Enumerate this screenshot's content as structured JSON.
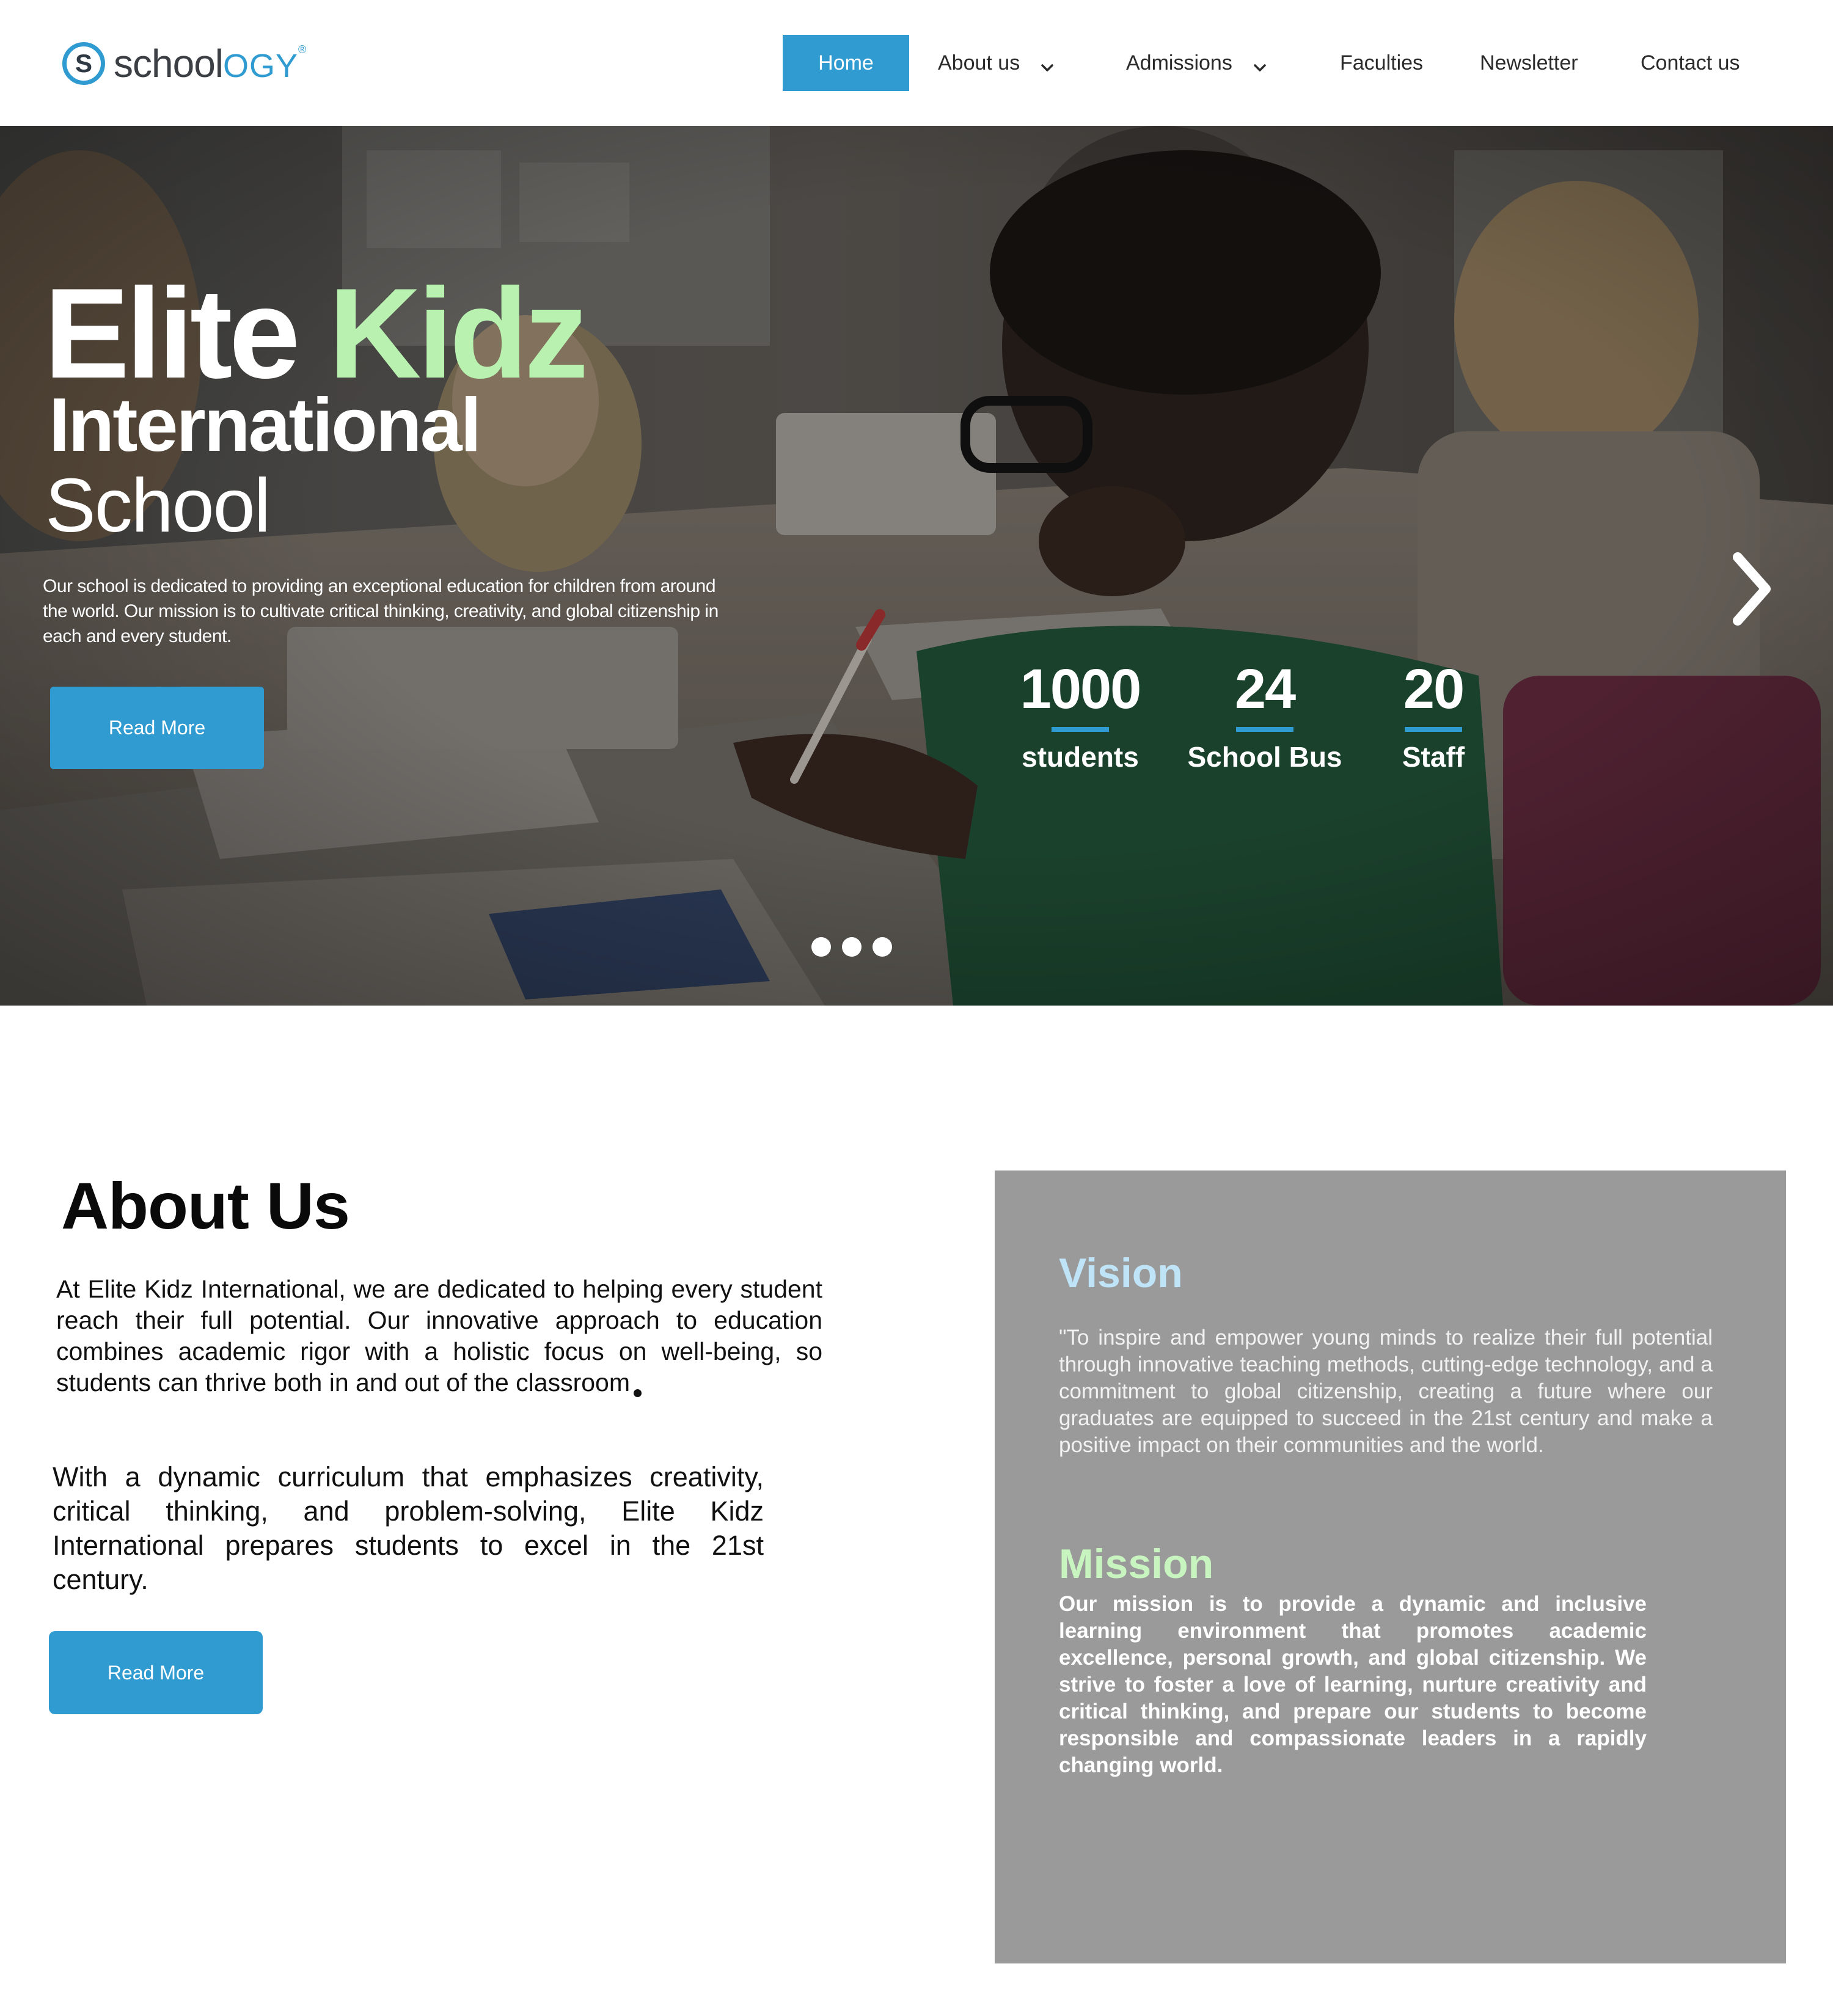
{
  "brand": {
    "logo_letter": "S",
    "logo_part1": "school",
    "logo_part2": "OGY",
    "logo_tm": "®",
    "accent_color": "#2f9bd0"
  },
  "nav": {
    "home": "Home",
    "about": "About us",
    "admissions": "Admissions",
    "faculties": "Faculties",
    "newsletter": "Newsletter",
    "contact": "Contact us"
  },
  "hero": {
    "title_white": "Elite",
    "title_green": "Kidz",
    "title_line2": "International",
    "title_line3": "School",
    "description": "Our school is dedicated to providing an exceptional education for children from around the world. Our mission is to cultivate critical thinking, creativity, and global citizenship in each and every student.",
    "cta": "Read More",
    "stats": [
      {
        "value": "1000",
        "label": "students"
      },
      {
        "value": "24",
        "label": "School Bus"
      },
      {
        "value": "20",
        "label": "Staff"
      }
    ],
    "slides": 3,
    "next_icon": "chevron-right-icon"
  },
  "about": {
    "title": "About Us",
    "paragraph1": "At Elite Kidz International, we are dedicated to helping every student reach their full potential. Our innovative approach to education combines academic rigor with a holistic focus on well-being, so students can thrive both in and out of the classroom",
    "paragraph2": "With a dynamic curriculum that emphasizes creativity, critical thinking, and problem-solving, Elite Kidz International prepares students to excel in the 21st century.",
    "cta": "Read More"
  },
  "vision": {
    "title": "Vision",
    "text": "\"To inspire and empower young minds to realize their full potential through innovative teaching methods, cutting-edge technology, and a commitment to global citizenship, creating a future where our graduates are equipped to succeed in the 21st century and make a positive impact on their communities and the world."
  },
  "mission": {
    "title": "Mission",
    "text": "Our mission is to provide a dynamic and inclusive learning environment that promotes academic excellence, personal growth, and global citizenship. We strive to foster a love of learning, nurture creativity and critical thinking, and prepare our students to become responsible and compassionate leaders in a rapidly changing world."
  }
}
